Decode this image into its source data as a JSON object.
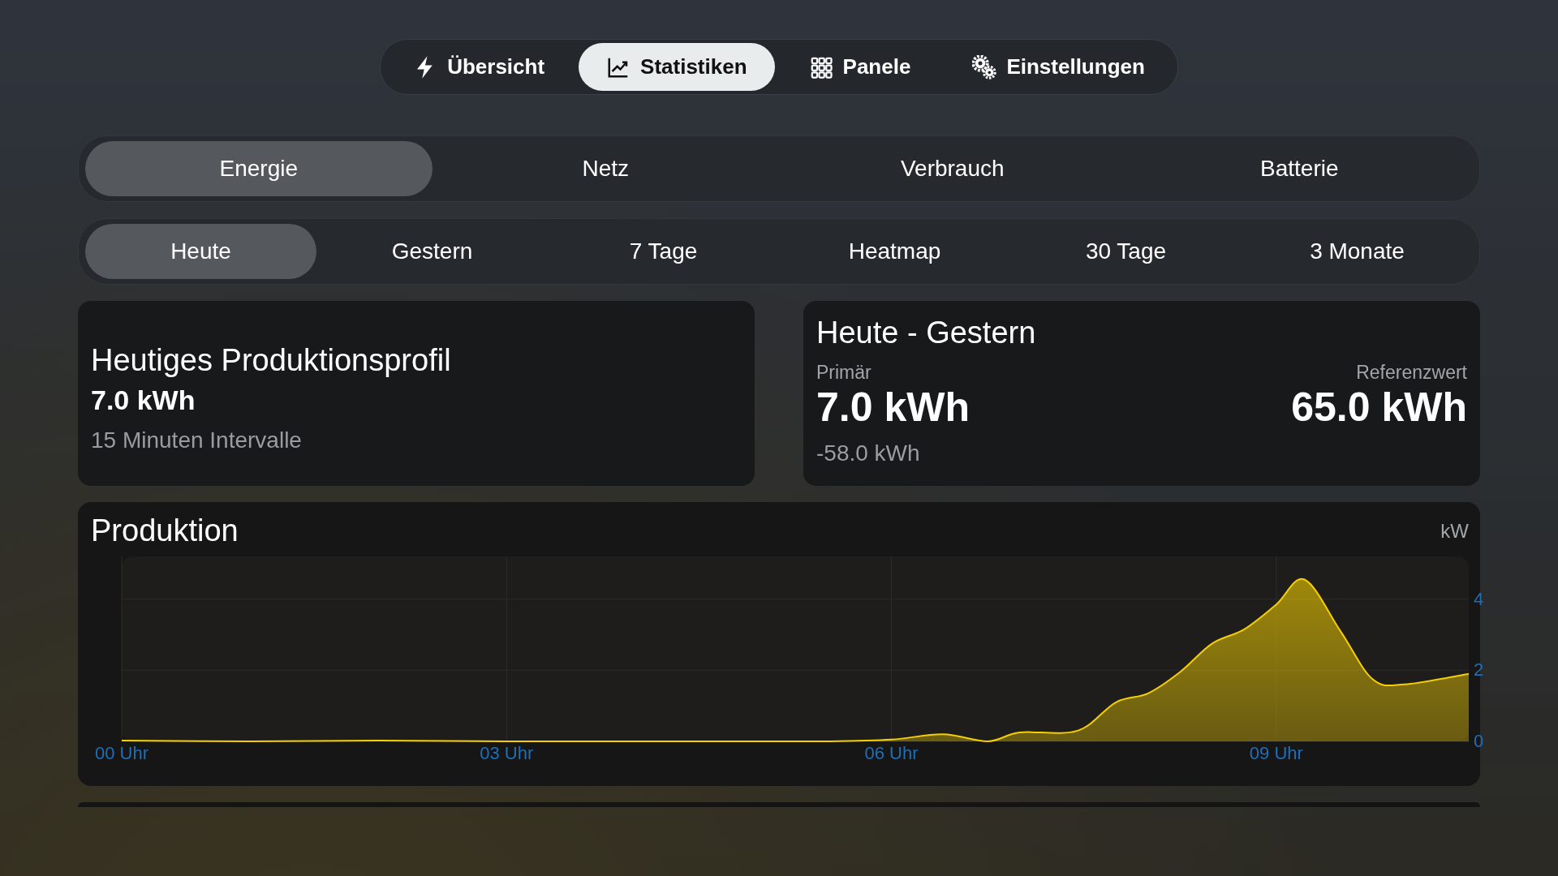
{
  "nav": [
    {
      "label": "Übersicht",
      "selected": false
    },
    {
      "label": "Statistiken",
      "selected": true
    },
    {
      "label": "Panele",
      "selected": false
    },
    {
      "label": "Einstellungen",
      "selected": false
    }
  ],
  "categories": [
    {
      "label": "Energie",
      "selected": true
    },
    {
      "label": "Netz",
      "selected": false
    },
    {
      "label": "Verbrauch",
      "selected": false
    },
    {
      "label": "Batterie",
      "selected": false
    }
  ],
  "periods": [
    {
      "label": "Heute",
      "selected": true
    },
    {
      "label": "Gestern",
      "selected": false
    },
    {
      "label": "7 Tage",
      "selected": false
    },
    {
      "label": "Heatmap",
      "selected": false
    },
    {
      "label": "30 Tage",
      "selected": false
    },
    {
      "label": "3 Monate",
      "selected": false
    }
  ],
  "profile_card": {
    "title": "Heutiges Produktionsprofil",
    "value": "7.0 kWh",
    "subtitle": "15 Minuten Intervalle"
  },
  "compare_card": {
    "title": "Heute - Gestern",
    "primary_label": "Primär",
    "primary_value": "7.0 kWh",
    "difference": "-58.0 kWh",
    "reference_label": "Referenzwert",
    "reference_value": "65.0 kWh"
  },
  "production": {
    "title": "Produktion",
    "unit": "kW",
    "chart_data": {
      "type": "area",
      "x": [
        0,
        1,
        2,
        3,
        4,
        5,
        5.5,
        6,
        6.4,
        6.75,
        7,
        7.45,
        7.75,
        8,
        8.25,
        8.5,
        8.75,
        9,
        9.22,
        9.5,
        9.75,
        10,
        10.5
      ],
      "series": [
        {
          "color": "#f5d000",
          "values": [
            0.02,
            0,
            0.02,
            0,
            0,
            0,
            0,
            0.05,
            0.2,
            0,
            0.25,
            0.3,
            1.1,
            1.35,
            1.95,
            2.75,
            3.15,
            3.85,
            4.55,
            3.1,
            1.75,
            1.6,
            1.9
          ]
        }
      ],
      "xticks": [
        {
          "value": 0,
          "label": "00 Uhr"
        },
        {
          "value": 3,
          "label": "03 Uhr"
        },
        {
          "value": 6,
          "label": "06 Uhr"
        },
        {
          "value": 9,
          "label": "09 Uhr"
        }
      ],
      "xlim": [
        0,
        10.5
      ],
      "ylim": [
        0,
        5.2
      ],
      "grid": true,
      "yticks": [
        0,
        2,
        4
      ]
    }
  }
}
